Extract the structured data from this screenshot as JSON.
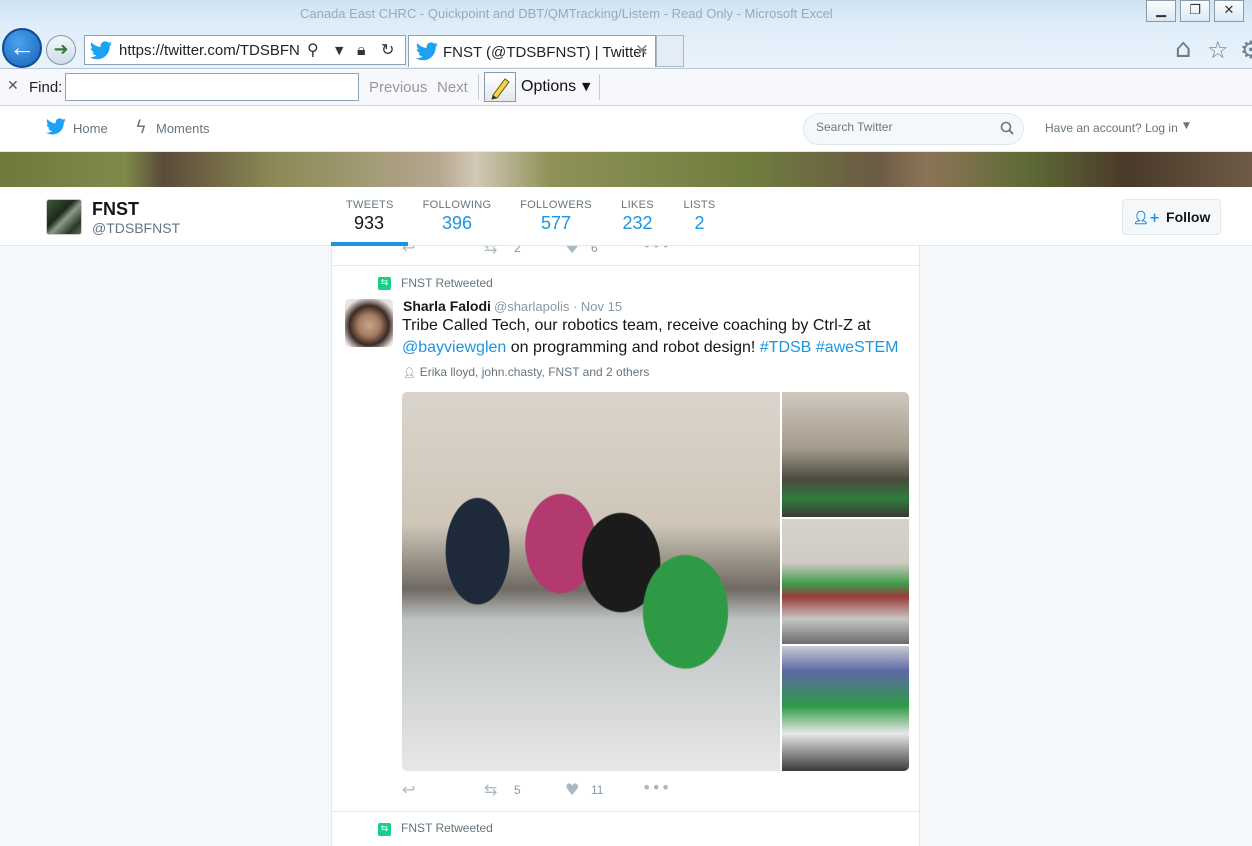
{
  "browser": {
    "window_title": "Canada East CHRC - Quickpoint and DBT/QMTracking/Listem - Read Only - Microsoft Excel",
    "url": "https://twitter.com/TDSBFN",
    "tab_title": "FNST (@TDSBFNST) | Twitter"
  },
  "find_bar": {
    "label": "Find:",
    "value": "",
    "previous": "Previous",
    "next": "Next",
    "options": "Options"
  },
  "twitter_nav": {
    "home": "Home",
    "moments": "Moments",
    "search_placeholder": "Search Twitter",
    "login": "Have an account? Log in"
  },
  "profile": {
    "name": "FNST",
    "handle": "@TDSBFNST",
    "stats": [
      {
        "label": "TWEETS",
        "value": "933"
      },
      {
        "label": "FOLLOWING",
        "value": "396"
      },
      {
        "label": "FOLLOWERS",
        "value": "577"
      },
      {
        "label": "LIKES",
        "value": "232"
      },
      {
        "label": "LISTS",
        "value": "2"
      }
    ],
    "follow_label": "Follow"
  },
  "prev_tweet": {
    "retweets": "2",
    "likes": "6"
  },
  "tweet": {
    "retweet_context": "FNST Retweeted",
    "author": "Sharla Falodi",
    "handle_date": "@sharlapolis · Nov 15",
    "text_part1": "Tribe Called Tech, our robotics team, receive coaching by Ctrl-Z at ",
    "mention": "@bayviewglen",
    "text_part2": " on programming and robot design! ",
    "hashtag1": "#TDSB",
    "hashtag2": "#aweSTEM",
    "likers": "Erika lloyd, john.chasty, FNST and 2 others",
    "retweets": "5",
    "likes": "11"
  },
  "next_tweet": {
    "retweet_context": "FNST Retweeted"
  },
  "colors": {
    "twitter_blue": "#1b95e0",
    "retweet_green": "#19cf86",
    "ie_back_blue": "#1562b8"
  },
  "icons": {
    "back": "back-arrow-icon",
    "forward": "forward-arrow-icon",
    "twitter_bird": "twitter-bird-icon",
    "home": "home-icon",
    "favorites": "star-icon",
    "tools": "gear-icon",
    "search": "search-icon",
    "lock": "lock-icon",
    "refresh": "refresh-icon",
    "reply": "reply-icon",
    "retweet": "retweet-icon",
    "like": "heart-icon",
    "more": "more-icon"
  }
}
